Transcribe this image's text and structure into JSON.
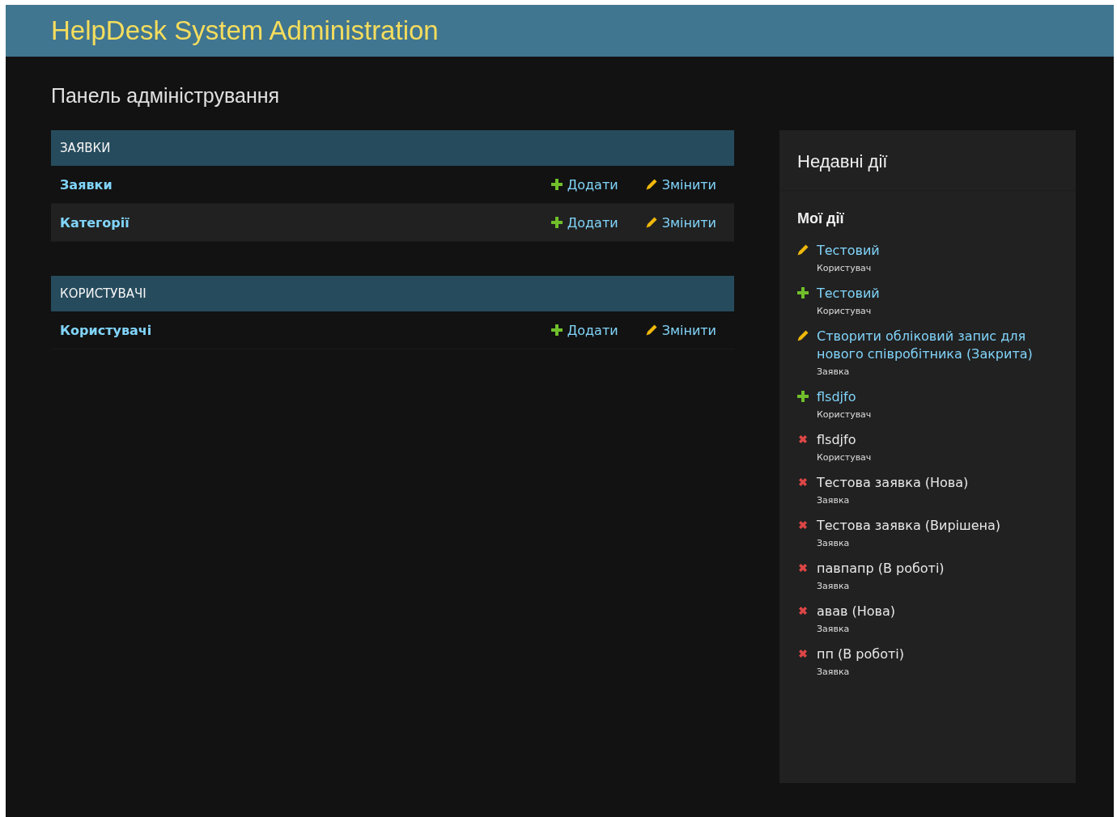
{
  "header": {
    "title": "HelpDesk System Administration"
  },
  "page_title": "Панель адміністрування",
  "modules": [
    {
      "caption": "ЗАЯВКИ",
      "rows": [
        {
          "name": "Заявки",
          "add": "Додати",
          "change": "Змінити"
        },
        {
          "name": "Категорії",
          "add": "Додати",
          "change": "Змінити"
        }
      ]
    },
    {
      "caption": "КОРИСТУВАЧІ",
      "rows": [
        {
          "name": "Користувачі",
          "add": "Додати",
          "change": "Змінити"
        }
      ]
    }
  ],
  "recent_actions": {
    "title": "Недавні дії",
    "subtitle": "Мої дії",
    "items": [
      {
        "kind": "change",
        "label": "Тестовий",
        "type": "Користувач"
      },
      {
        "kind": "addition",
        "label": "Тестовий",
        "type": "Користувач"
      },
      {
        "kind": "change",
        "label": "Створити обліковий запис для нового співробітника (Закрита)",
        "type": "Заявка"
      },
      {
        "kind": "addition",
        "label": "flsdjfo",
        "type": "Користувач"
      },
      {
        "kind": "deletion",
        "label": "flsdjfo",
        "type": "Користувач"
      },
      {
        "kind": "deletion",
        "label": "Тестова заявка (Нова)",
        "type": "Заявка"
      },
      {
        "kind": "deletion",
        "label": "Тестова заявка (Вирішена)",
        "type": "Заявка"
      },
      {
        "kind": "deletion",
        "label": "павпапр (В роботі)",
        "type": "Заявка"
      },
      {
        "kind": "deletion",
        "label": "авав (Нова)",
        "type": "Заявка"
      },
      {
        "kind": "deletion",
        "label": "пп (В роботі)",
        "type": "Заявка"
      }
    ]
  }
}
